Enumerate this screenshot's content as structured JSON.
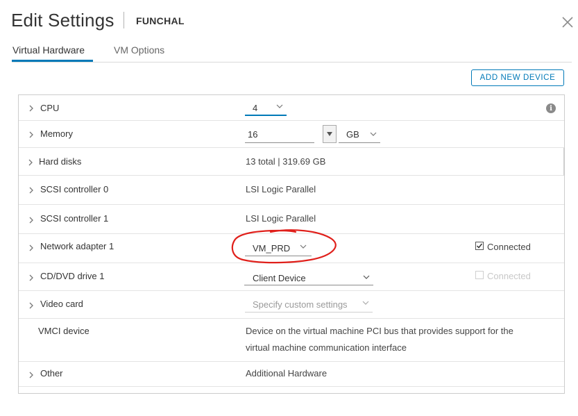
{
  "dialog": {
    "title": "Edit Settings",
    "vm_name": "FUNCHAL"
  },
  "tabs": [
    {
      "label": "Virtual Hardware",
      "active": true
    },
    {
      "label": "VM Options",
      "active": false
    }
  ],
  "toolbar": {
    "add_device_label": "ADD NEW DEVICE"
  },
  "rows": {
    "cpu": {
      "label": "CPU",
      "value": "4"
    },
    "memory": {
      "label": "Memory",
      "value": "16",
      "unit": "GB"
    },
    "hard_disks": {
      "label": "Hard disks",
      "value": "13 total | 319.69 GB"
    },
    "scsi0": {
      "label": "SCSI controller 0",
      "value": "LSI Logic Parallel"
    },
    "scsi1": {
      "label": "SCSI controller 1",
      "value": "LSI Logic Parallel"
    },
    "network": {
      "label": "Network adapter 1",
      "value": "VM_PRD",
      "connected_label": "Connected",
      "connected": true
    },
    "cddvd": {
      "label": "CD/DVD drive 1",
      "value": "Client Device",
      "connected_label": "Connected",
      "connected": false
    },
    "video": {
      "label": "Video card",
      "value": "Specify custom settings"
    },
    "vmci": {
      "label": "VMCI device",
      "desc_line1": "Device on the virtual machine PCI bus that provides support for the",
      "desc_line2": "virtual machine communication interface"
    },
    "other": {
      "label": "Other",
      "value": "Additional Hardware"
    }
  },
  "colors": {
    "accent": "#0079b8",
    "annotation": "#e0201b"
  },
  "icons": [
    "close-icon",
    "chevron-right-icon",
    "chevron-down-icon",
    "info-icon",
    "checkbox-checked-icon",
    "caret-down-icon"
  ]
}
